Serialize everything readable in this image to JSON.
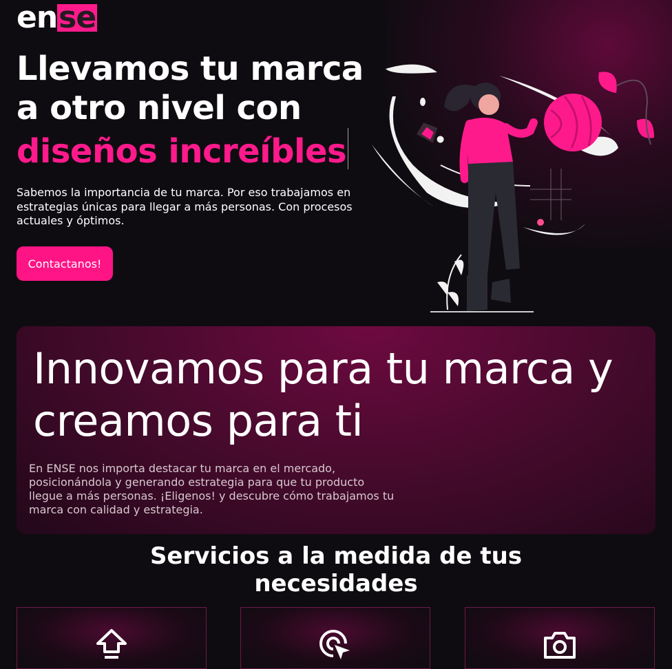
{
  "logo": {
    "part_a": "en",
    "part_b": "se"
  },
  "hero": {
    "title_line1": "Llevamos tu marca",
    "title_line2": "a otro nivel con",
    "title_accent": "diseños increíbles",
    "description": "Sabemos la importancia de tu marca. Por eso trabajamos en estrategias únicas para llegar a más personas. Con procesos actuales y óptimos.",
    "cta_label": "Contactanos!"
  },
  "about": {
    "title": "Innovamos para tu marca y creamos para ti",
    "text": "En ENSE nos importa destacar tu marca en el mercado, posicionándola y generando estrategia para que tu producto llegue a más personas. ¡Eligenos! y descubre cómo trabajamos tu marca con calidad y estrategia."
  },
  "services": {
    "title_line1": "Servicios a la medida de tus",
    "title_line2": "necesidades",
    "cards": [
      {
        "icon": "upload-icon"
      },
      {
        "icon": "cursor-click-icon"
      },
      {
        "icon": "camera-icon"
      }
    ]
  },
  "colors": {
    "accent": "#ff1a8c",
    "background": "#0f0c11",
    "card": "#4a0a2e"
  }
}
